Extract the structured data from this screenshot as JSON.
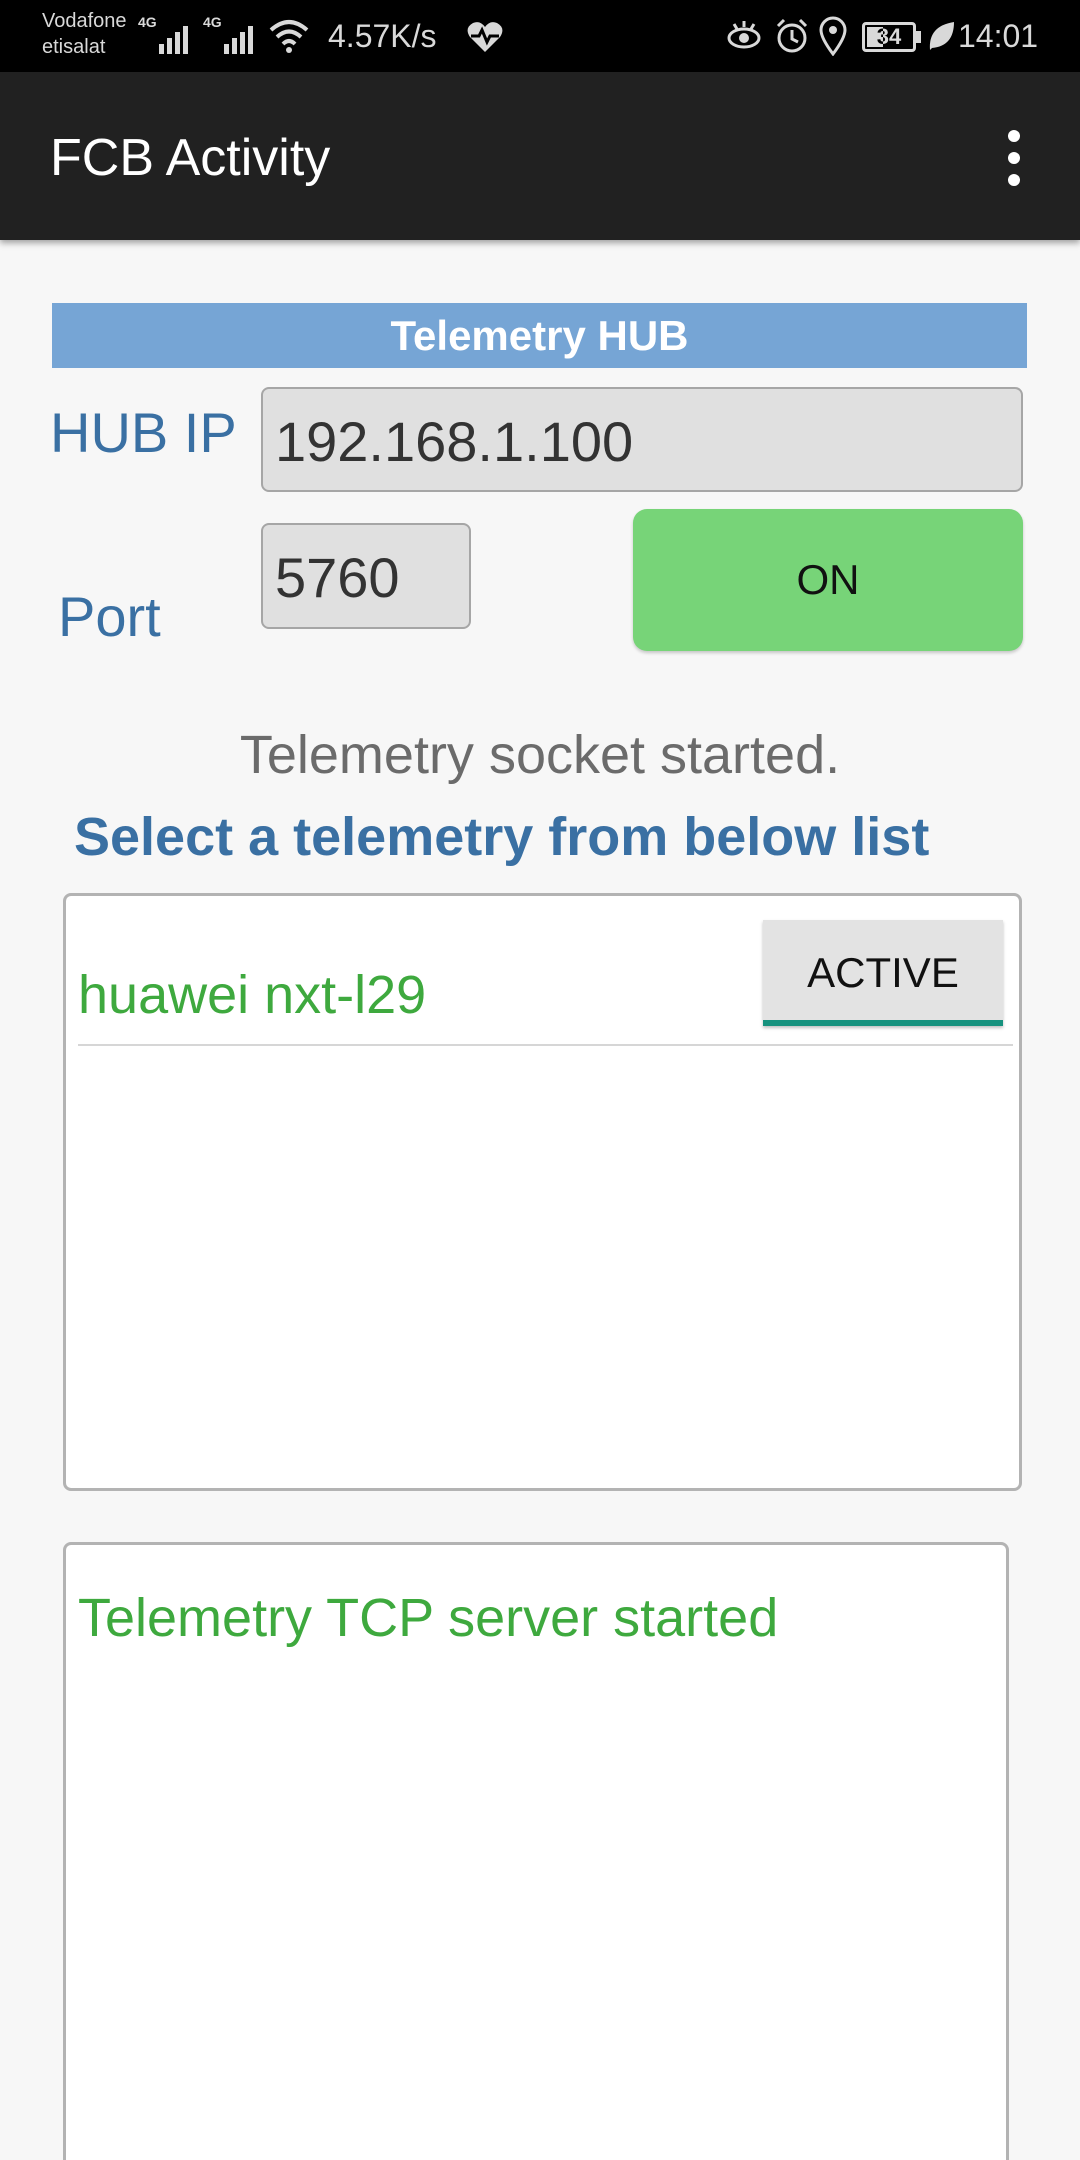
{
  "status_bar": {
    "carrier_1": "Vodafone",
    "carrier_2": "etisalat",
    "net_1": "4G",
    "net_2": "4G",
    "speed": "4.57K/s",
    "battery_level": "34",
    "time": "14:01",
    "icons": [
      "signal-icon",
      "signal-icon",
      "wifi-icon",
      "health-icon",
      "eye-icon",
      "alarm-icon",
      "location-icon",
      "battery-icon",
      "leaf-icon"
    ]
  },
  "app_bar": {
    "title": "FCB Activity",
    "menu_icon": "more-vert-icon"
  },
  "hub": {
    "header": "Telemetry HUB",
    "ip_label": "HUB IP",
    "ip_value": "192.168.1.100",
    "port_label": "Port",
    "port_value": "5760",
    "toggle_label": "ON"
  },
  "status_message": "Telemetry socket started.",
  "list": {
    "title": "Select a telemetry from below list",
    "items": [
      {
        "name": "huawei nxt-l29",
        "button_label": "ACTIVE"
      }
    ]
  },
  "log": {
    "lines": [
      "Telemetry TCP server started"
    ]
  },
  "colors": {
    "header_bg": "#76a5d5",
    "label_blue": "#3a70a3",
    "on_button": "#77d478",
    "green_text": "#3ea93e",
    "accent_teal": "#16927e",
    "app_bar": "#212121"
  }
}
